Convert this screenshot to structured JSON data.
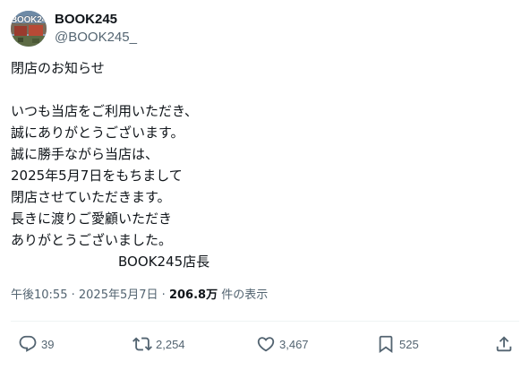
{
  "author": {
    "avatar_text": "BOOK245",
    "display_name": "BOOK245",
    "handle": "@BOOK245_"
  },
  "post": {
    "lines": [
      "閉店のお知らせ",
      "",
      "いつも当店をご利用いただき、",
      "誠にありがとうございます。",
      "誠に勝手ながら当店は、",
      "2025年5月7日をもちまして",
      "閉店させていただきます。",
      "長きに渡りご愛顧いただき",
      "ありがとうございました。"
    ],
    "signature": "BOOK245店長"
  },
  "meta": {
    "time": "午後10:55",
    "separator": "·",
    "date": "2025年5月7日",
    "views_count": "206.8万",
    "views_label": "件の表示"
  },
  "actions": {
    "replies": "39",
    "reposts": "2,254",
    "likes": "3,467",
    "bookmarks": "525"
  },
  "icons": {
    "reply": "reply-icon",
    "repost": "repost-icon",
    "like": "heart-icon",
    "bookmark": "bookmark-icon",
    "share": "share-icon"
  },
  "colors": {
    "text": "#0f1419",
    "secondary": "#536471",
    "divider": "#eff3f4"
  }
}
